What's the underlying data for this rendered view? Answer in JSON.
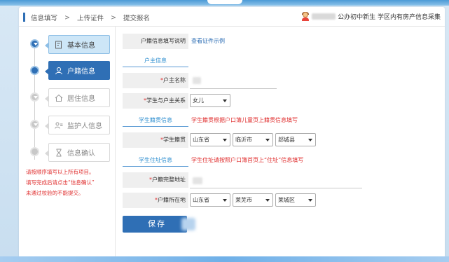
{
  "breadcrumb": {
    "step1": "信息填写",
    "sep": ">",
    "step2": "上传证件",
    "step3": "提交报名"
  },
  "header": {
    "user_suffix": "公办初中新生 学区内有房产信息采集"
  },
  "steps": [
    {
      "label": "基本信息",
      "state": "selected",
      "icon": "edit-icon"
    },
    {
      "label": "户籍信息",
      "state": "current",
      "icon": "user-icon"
    },
    {
      "label": "居住信息",
      "state": "inactive",
      "icon": "home-icon"
    },
    {
      "label": "监护人信息",
      "state": "inactive",
      "icon": "id-card-icon"
    },
    {
      "label": "信息确认",
      "state": "inactive",
      "icon": "hourglass-icon"
    }
  ],
  "notes": {
    "line1": "请按顺序填写以上所有项目。",
    "line2": "填写完成后请点击“信息确认”",
    "line3": "未通过校验的不能提交。"
  },
  "form": {
    "instruction_label": "户籍信息填写说明",
    "instruction_link": "查看证件示例",
    "section_household": "户主信息",
    "householder_name_label": "户主名称",
    "relation_label": "学生与户主关系",
    "relation_value": "女儿",
    "section_native": "学生籍贯信息",
    "native_hint": "学生籍贯根据户口簿儿童页上籍贯信息填写",
    "native_label": "学生籍贯",
    "native_province": "山东省",
    "native_city": "临沂市",
    "native_county": "郯城县",
    "section_residence": "学生住址信息",
    "residence_hint": "学生住址请按照户口簿首页上“住址”信息填写",
    "address_label": "户籍完整地址",
    "location_label": "户籍所在地",
    "loc_province": "山东省",
    "loc_city": "莱芜市",
    "loc_district": "莱城区",
    "required_mark": "*",
    "save_label": "保存"
  },
  "colors": {
    "primary": "#2f6fb5",
    "selected_bg": "#cde6f7",
    "required": "#e03030",
    "section_title": "#2f8fd0"
  }
}
